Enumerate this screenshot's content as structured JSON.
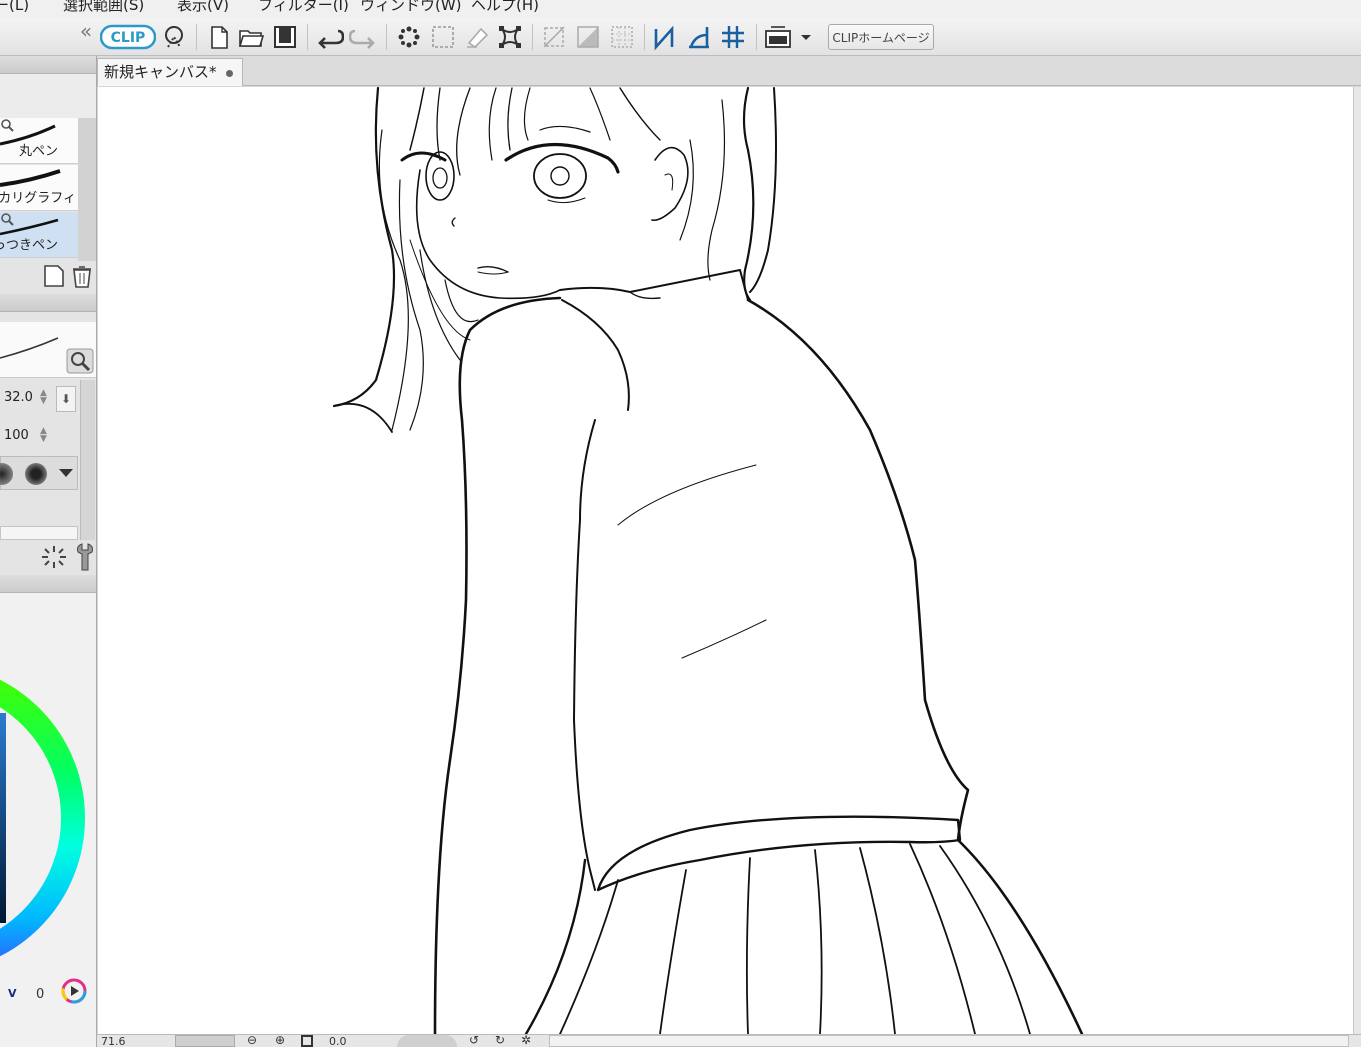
{
  "menu": {
    "items": [
      "ー(L)",
      "選択範囲(S)",
      "表示(V)",
      "フィルター(I)",
      "ウィンドウ(W)",
      "ヘルプ(H)"
    ]
  },
  "toolbar": {
    "logo_label": "CLIP",
    "home_button_label": "CLIPホームページ",
    "collapse_glyph": "«",
    "icons": [
      "clip-logo-icon",
      "companion-icon",
      "new-file-icon",
      "open-folder-icon",
      "save-icon",
      "undo-icon",
      "redo-icon",
      "deselect-icon",
      "select-all-icon",
      "clear-icon",
      "transform-icon",
      "hide-selection-icon",
      "fill-selection-icon",
      "show-grid-icon",
      "ruler-snap-icon",
      "perspective-snap-icon",
      "special-ruler-snap-icon",
      "layer-dropdown-icon"
    ]
  },
  "tabs": {
    "active_label": "新規キャンバス*"
  },
  "brushes": {
    "items": [
      {
        "label": "丸ペン",
        "selected": false
      },
      {
        "label": "カリグラフィ",
        "selected": false
      },
      {
        "label": "っつきペン",
        "selected": true
      }
    ]
  },
  "tool_property": {
    "brush_size": "32.0",
    "opacity": "100"
  },
  "color": {
    "value_label": "V",
    "value_number": "0"
  },
  "statusbar": {
    "zoom": "71.6",
    "rotation": "0.0"
  },
  "colors": {
    "accent": "#3a8fd0",
    "selection": "#cfe0f2"
  }
}
